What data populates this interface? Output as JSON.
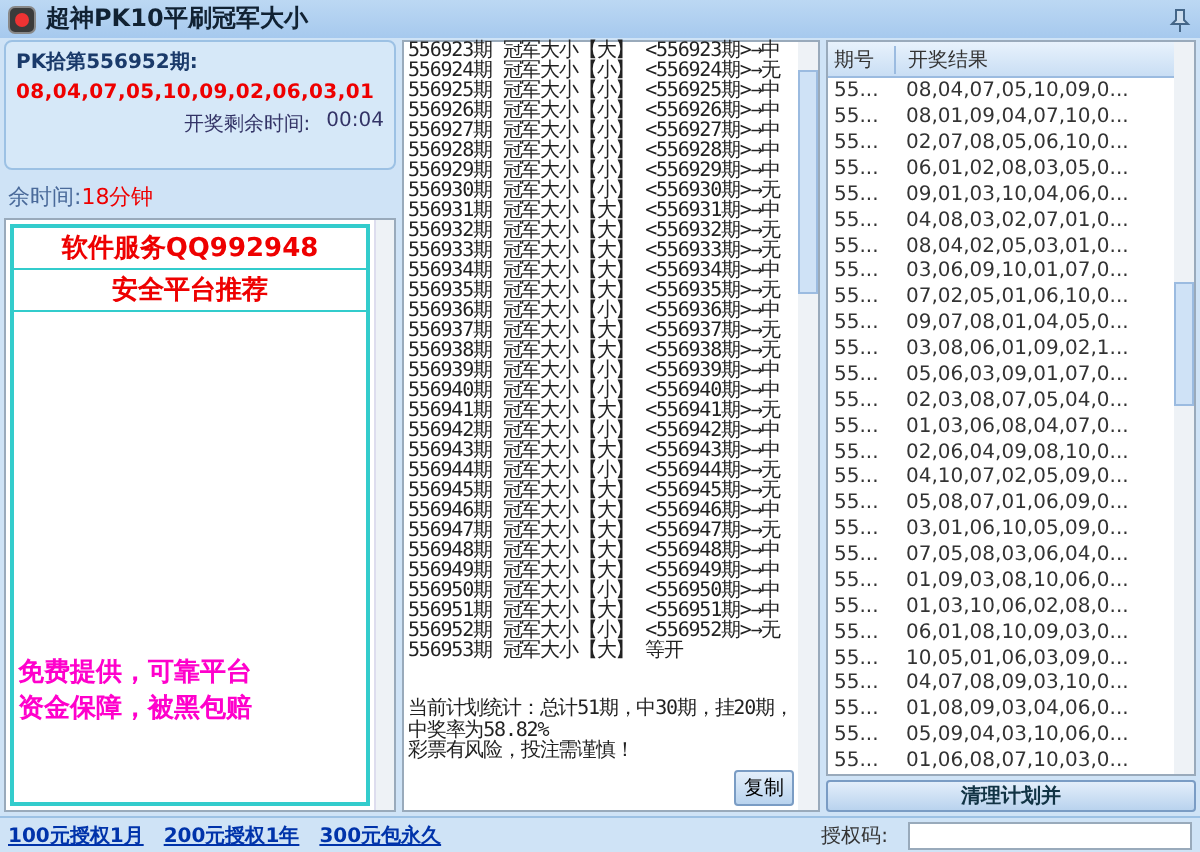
{
  "window": {
    "title": "超神PK10平刷冠军大小"
  },
  "draw_info": {
    "period": "PK拾第556952期:",
    "numbers": "08,04,07,05,10,09,02,06,03,01",
    "countdown_label": "开奖剩余时间:",
    "countdown": "00:04"
  },
  "remaining": {
    "label": "余时间:",
    "value": "18分钟"
  },
  "ad_panel": {
    "lines": [
      "软件服务QQ992948",
      "安全平台推荐"
    ],
    "footer": [
      "免费提供，可靠平台",
      "资金保障，被黑包赔"
    ]
  },
  "plan_log": {
    "lines": [
      "556923期 冠军大小【大】 <556923期>→中",
      "556924期 冠军大小【小】 <556924期>→无",
      "556925期 冠军大小【小】 <556925期>→中",
      "556926期 冠军大小【小】 <556926期>→中",
      "556927期 冠军大小【小】 <556927期>→中",
      "556928期 冠军大小【小】 <556928期>→中",
      "556929期 冠军大小【小】 <556929期>→中",
      "556930期 冠军大小【小】 <556930期>→无",
      "556931期 冠军大小【大】 <556931期>→中",
      "556932期 冠军大小【大】 <556932期>→无",
      "556933期 冠军大小【大】 <556933期>→无",
      "556934期 冠军大小【大】 <556934期>→中",
      "556935期 冠军大小【大】 <556935期>→无",
      "556936期 冠军大小【小】 <556936期>→中",
      "556937期 冠军大小【大】 <556937期>→无",
      "556938期 冠军大小【大】 <556938期>→无",
      "556939期 冠军大小【小】 <556939期>→中",
      "556940期 冠军大小【小】 <556940期>→中",
      "556941期 冠军大小【大】 <556941期>→无",
      "556942期 冠军大小【小】 <556942期>→中",
      "556943期 冠军大小【大】 <556943期>→中",
      "556944期 冠军大小【小】 <556944期>→无",
      "556945期 冠军大小【大】 <556945期>→无",
      "556946期 冠军大小【大】 <556946期>→中",
      "556947期 冠军大小【大】 <556947期>→无",
      "556948期 冠军大小【大】 <556948期>→中",
      "556949期 冠军大小【大】 <556949期>→中",
      "556950期 冠军大小【小】 <556950期>→中",
      "556951期 冠军大小【大】 <556951期>→中",
      "556952期 冠军大小【小】 <556952期>→无",
      "556953期 冠军大小【大】 等开"
    ],
    "summary": "当前计划统计：总计51期，中30期，挂20期，中奖率为58.82%",
    "warning": "彩票有风险，投注需谨慎！",
    "copy_button": "复制"
  },
  "results_table": {
    "columns": [
      "期号",
      "开奖结果"
    ],
    "rows": [
      [
        "55...",
        "08,04,07,05,10,09,0..."
      ],
      [
        "55...",
        "08,01,09,04,07,10,0..."
      ],
      [
        "55...",
        "02,07,08,05,06,10,0..."
      ],
      [
        "55...",
        "06,01,02,08,03,05,0..."
      ],
      [
        "55...",
        "09,01,03,10,04,06,0..."
      ],
      [
        "55...",
        "04,08,03,02,07,01,0..."
      ],
      [
        "55...",
        "08,04,02,05,03,01,0..."
      ],
      [
        "55...",
        "03,06,09,10,01,07,0..."
      ],
      [
        "55...",
        "07,02,05,01,06,10,0..."
      ],
      [
        "55...",
        "09,07,08,01,04,05,0..."
      ],
      [
        "55...",
        "03,08,06,01,09,02,1..."
      ],
      [
        "55...",
        "05,06,03,09,01,07,0..."
      ],
      [
        "55...",
        "02,03,08,07,05,04,0..."
      ],
      [
        "55...",
        "01,03,06,08,04,07,0..."
      ],
      [
        "55...",
        "02,06,04,09,08,10,0..."
      ],
      [
        "55...",
        "04,10,07,02,05,09,0..."
      ],
      [
        "55...",
        "05,08,07,01,06,09,0..."
      ],
      [
        "55...",
        "03,01,06,10,05,09,0..."
      ],
      [
        "55...",
        "07,05,08,03,06,04,0..."
      ],
      [
        "55...",
        "01,09,03,08,10,06,0..."
      ],
      [
        "55...",
        "01,03,10,06,02,08,0..."
      ],
      [
        "55...",
        "06,01,08,10,09,03,0..."
      ],
      [
        "55...",
        "10,05,01,06,03,09,0..."
      ],
      [
        "55...",
        "04,07,08,09,03,10,0..."
      ],
      [
        "55...",
        "01,08,09,03,04,06,0..."
      ],
      [
        "55...",
        "05,09,04,03,10,06,0..."
      ],
      [
        "55...",
        "01,06,08,07,10,03,0..."
      ]
    ],
    "clear_button": "清理计划并"
  },
  "footer": {
    "links": [
      "100元授权1月",
      "200元授权1年",
      "300元包永久"
    ],
    "auth_label": "授权码:"
  }
}
